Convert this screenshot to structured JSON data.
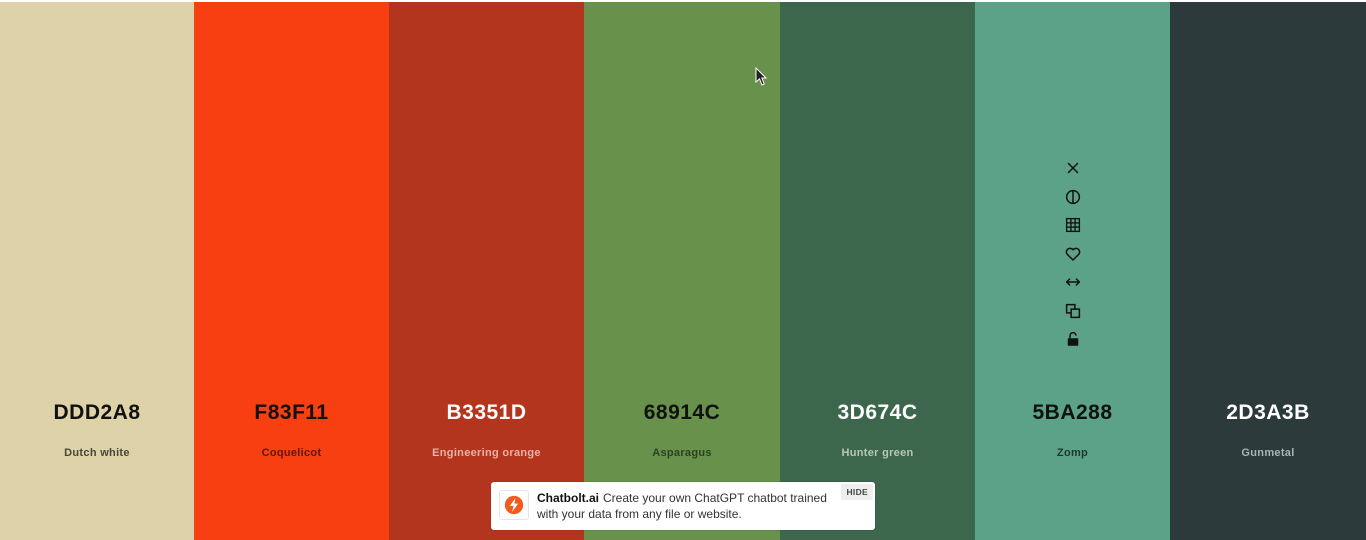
{
  "palette": {
    "colors": [
      {
        "hex": "DDD2A8",
        "name": "Dutch white",
        "bg": "#DDD2A8",
        "text_color": "#111111",
        "name_color": "#4a4535"
      },
      {
        "hex": "F83F11",
        "name": "Coquelicot",
        "bg": "#F83F11",
        "text_color": "#111111",
        "name_color": "#5a1a08"
      },
      {
        "hex": "B3351D",
        "name": "Engineering orange",
        "bg": "#B3351D",
        "text_color": "#ffffff",
        "name_color": "#e6b3a8"
      },
      {
        "hex": "68914C",
        "name": "Asparagus",
        "bg": "#68914C",
        "text_color": "#111111",
        "name_color": "#2e3f22"
      },
      {
        "hex": "3D674C",
        "name": "Hunter green",
        "bg": "#3D674C",
        "text_color": "#ffffff",
        "name_color": "#b6c8bc"
      },
      {
        "hex": "5BA288",
        "name": "Zomp",
        "bg": "#5BA288",
        "text_color": "#111111",
        "name_color": "#20372e"
      },
      {
        "hex": "2D3A3B",
        "name": "Gunmetal",
        "bg": "#2D3A3B",
        "text_color": "#ffffff",
        "name_color": "#aab2b3"
      }
    ],
    "hovered_tools": [
      "close-icon",
      "contrast-icon",
      "shades-grid-icon",
      "heart-icon",
      "drag-arrows-icon",
      "copy-icon",
      "unlock-icon"
    ]
  },
  "ad": {
    "brand": "Chatbolt.ai",
    "text": "Create your own ChatGPT chatbot trained with your data from any file or website.",
    "hide_label": "HIDE",
    "accent": "#F25A1E"
  }
}
